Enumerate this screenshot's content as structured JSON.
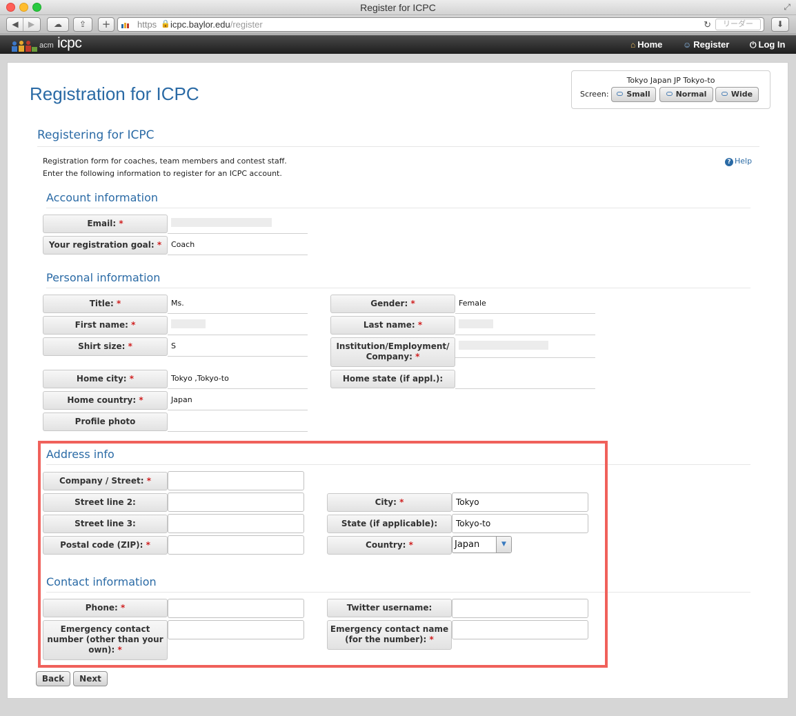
{
  "window": {
    "title": "Register for ICPC"
  },
  "toolbar": {
    "url_scheme": "https",
    "url_host": "icpc.baylor.edu",
    "url_path": "/register",
    "reader_label": "リーダー"
  },
  "nav": {
    "logo_acm": "acm",
    "logo_icpc": "icpc",
    "home": "Home",
    "register": "Register",
    "login": "Log In"
  },
  "page": {
    "title": "Registration for ICPC",
    "location": "Tokyo Japan JP Tokyo-to",
    "screen_label": "Screen:",
    "screen_buttons": [
      "Small",
      "Normal",
      "Wide"
    ],
    "section_title": "Registering for ICPC",
    "intro1": "Registration form for coaches, team members and contest staff.",
    "intro2": "Enter the following information to register for an ICPC account.",
    "help": "Help"
  },
  "account": {
    "heading": "Account information",
    "email_label": "Email:",
    "goal_label": "Your registration goal:",
    "goal_value": "Coach"
  },
  "personal": {
    "heading": "Personal information",
    "title_label": "Title:",
    "title_value": "Ms.",
    "gender_label": "Gender:",
    "gender_value": "Female",
    "first_label": "First name:",
    "last_label": "Last name:",
    "shirt_label": "Shirt size:",
    "shirt_value": "S",
    "inst_label_1": "Institution/Employment/",
    "inst_label_2": "Company:",
    "city_label": "Home city:",
    "city_value": "Tokyo ,Tokyo-to",
    "state_label": "Home state (if appl.):",
    "country_label": "Home country:",
    "country_value": "Japan",
    "photo_label": "Profile photo"
  },
  "address": {
    "heading": "Address info",
    "street_label": "Company / Street:",
    "street_value": "",
    "street2_label": "Street line 2:",
    "street2_value": "",
    "street3_label": "Street line 3:",
    "street3_value": "",
    "postal_label": "Postal code (ZIP):",
    "postal_value": "",
    "city_label": "City:",
    "city_value": "Tokyo",
    "state_label": "State (if applicable):",
    "state_value": "Tokyo-to",
    "country_label": "Country:",
    "country_value": "Japan"
  },
  "contact": {
    "heading": "Contact information",
    "phone_label": "Phone:",
    "phone_value": "",
    "twitter_label": "Twitter username:",
    "twitter_value": "",
    "emergency_number_label_1": "Emergency contact",
    "emergency_number_label_2": "number (other than your",
    "emergency_number_label_3": "own):",
    "emergency_number_value": "",
    "emergency_name_label_1": "Emergency contact name",
    "emergency_name_label_2": "(for the number):",
    "emergency_name_value": ""
  },
  "buttons": {
    "back": "Back",
    "next": "Next"
  },
  "colors": {
    "accent": "#2a6aa5",
    "required": "#d02020",
    "highlight": "#f0615b"
  }
}
